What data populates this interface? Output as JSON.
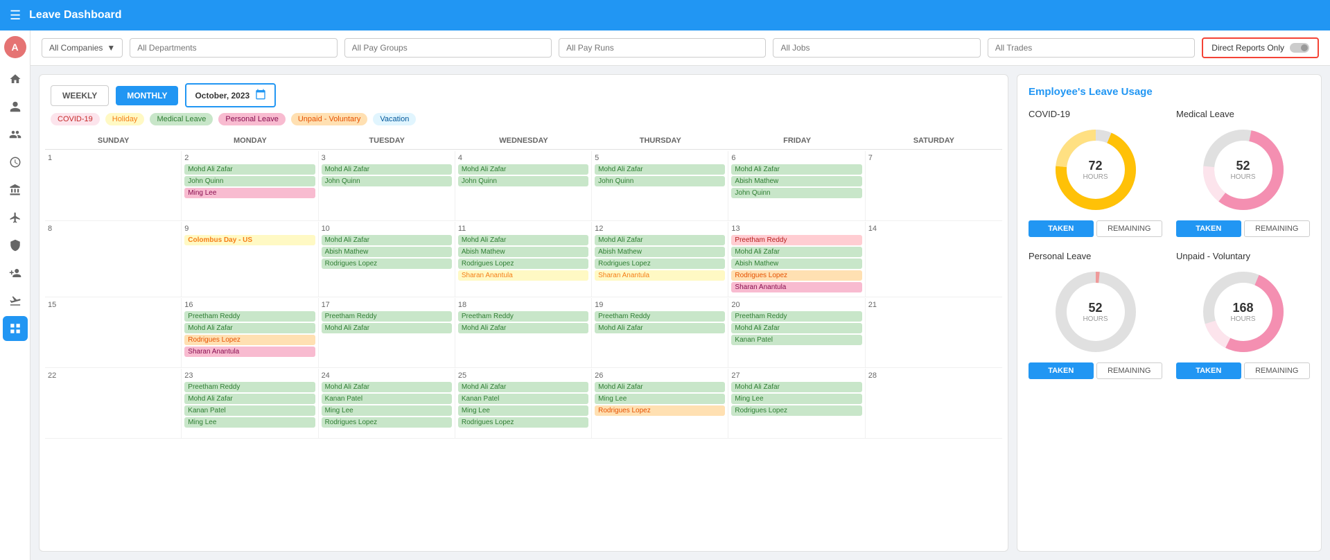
{
  "topbar": {
    "title": "Leave Dashboard",
    "hamburger_icon": "☰"
  },
  "filters": {
    "companies": "All Companies",
    "departments": "All Departments",
    "pay_groups": "All Pay Groups",
    "pay_runs": "All Pay Runs",
    "jobs": "All Jobs",
    "trades": "All Trades",
    "direct_reports": "Direct Reports Only"
  },
  "calendar": {
    "view_weekly": "WEEKLY",
    "view_monthly": "MONTHLY",
    "current_date": "October, 2023",
    "calendar_icon": "📅",
    "days": [
      "SUNDAY",
      "MONDAY",
      "TUESDAY",
      "WEDNESDAY",
      "THURSDAY",
      "FRIDAY",
      "SATURDAY"
    ],
    "legend": [
      {
        "label": "COVID-19",
        "bg": "#fce4ec",
        "color": "#c62828"
      },
      {
        "label": "Holiday",
        "bg": "#fff9c4",
        "color": "#f57f17"
      },
      {
        "label": "Medical Leave",
        "bg": "#c8e6c9",
        "color": "#2e7d32"
      },
      {
        "label": "Personal Leave",
        "bg": "#f8bbd0",
        "color": "#880e4f"
      },
      {
        "label": "Unpaid - Voluntary",
        "bg": "#ffe0b2",
        "color": "#e65100"
      },
      {
        "label": "Vacation",
        "bg": "#e1f5fe",
        "color": "#01579b"
      }
    ]
  },
  "right_panel": {
    "title": "Employee's Leave Usage",
    "charts": [
      {
        "label": "COVID-19",
        "hours": 72,
        "taken_label": "TAKEN",
        "remaining_label": "REMAINING"
      },
      {
        "label": "Medical Leave",
        "hours": 52,
        "taken_label": "TAKEN",
        "remaining_label": "REMAINING"
      },
      {
        "label": "Personal Leave",
        "hours": 52,
        "taken_label": "TAKEN",
        "remaining_label": "REMAINING"
      },
      {
        "label": "Unpaid - Voluntary",
        "hours": 168,
        "taken_label": "TAKEN",
        "remaining_label": "REMAINING"
      }
    ]
  },
  "sidebar": {
    "icons": [
      "☰",
      "🏠",
      "👤",
      "👥",
      "⏰",
      "🏦",
      "✈",
      "🔒",
      "👤+",
      "✈",
      "✈+",
      "⊞"
    ]
  }
}
